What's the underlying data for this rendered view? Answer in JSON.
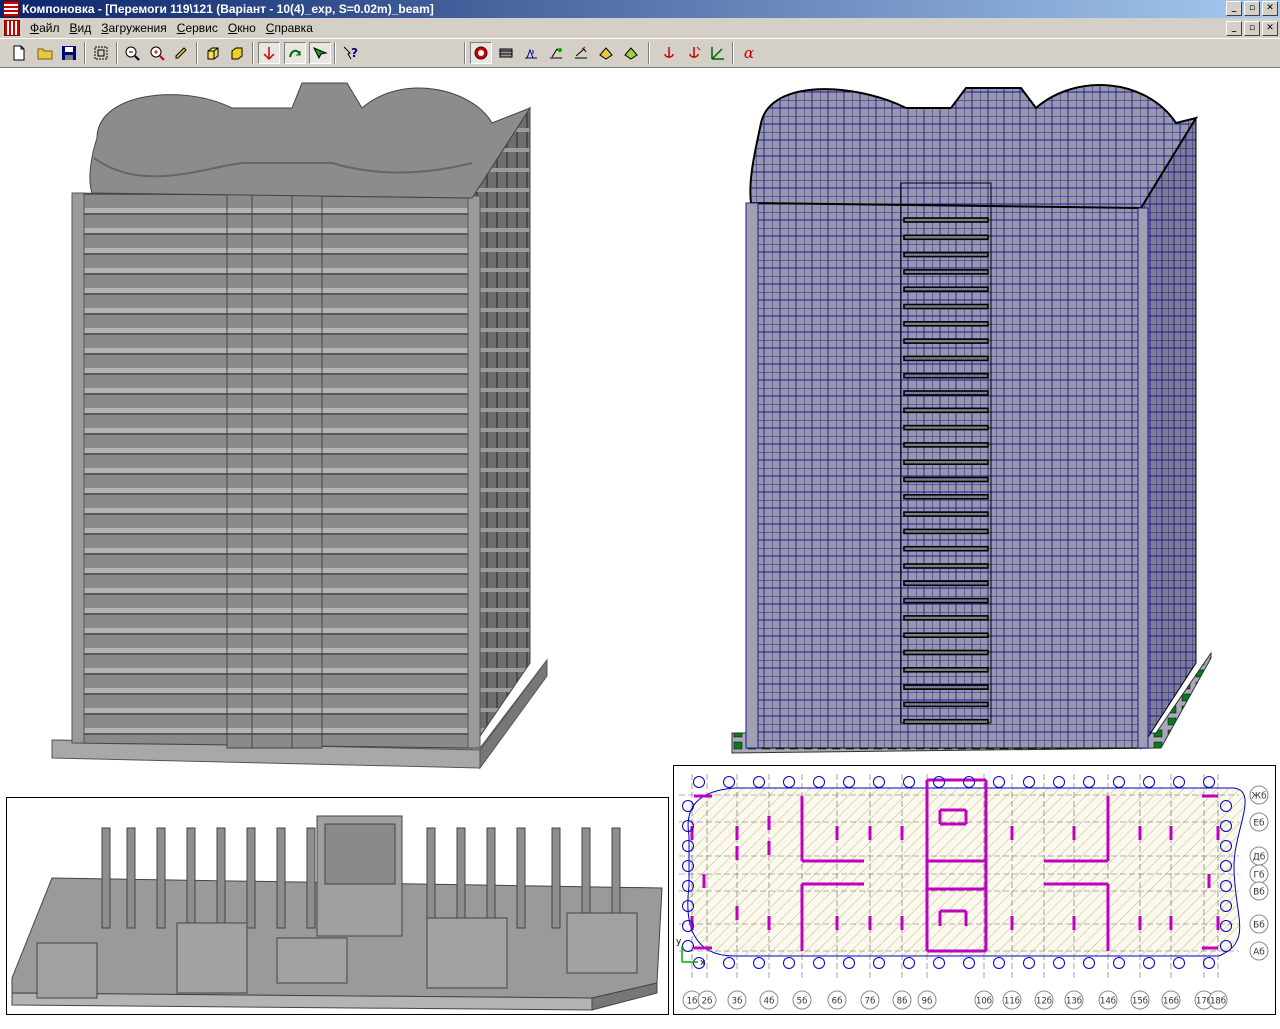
{
  "window": {
    "title": "Компоновка - [Перемоги 119\\121  (Варіант - 10(4)_exp, S=0.02m)_beam]",
    "controls": [
      "_",
      "▫",
      "✕"
    ]
  },
  "menu": {
    "items": [
      "Файл",
      "Вид",
      "Загружения",
      "Сервис",
      "Окно",
      "Справка"
    ],
    "mnemonics": [
      "Ф",
      "В",
      "З",
      "С",
      "О",
      "С"
    ]
  },
  "toolbar": {
    "buttons": [
      {
        "name": "new-icon",
        "glyph": "🗋"
      },
      {
        "name": "open-icon",
        "glyph": "📂"
      },
      {
        "name": "save-icon",
        "glyph": "💾"
      },
      {
        "name": "fit-icon",
        "glyph": "⛶"
      },
      {
        "name": "zoom-out-icon",
        "glyph": "🔍"
      },
      {
        "name": "zoom-in-icon",
        "glyph": "⊕"
      },
      {
        "name": "pencil-icon",
        "glyph": "✎"
      },
      {
        "name": "cube-icon",
        "glyph": "◧"
      },
      {
        "name": "cube-solid-icon",
        "glyph": "◨"
      },
      {
        "name": "axes-icon",
        "glyph": "⚓"
      },
      {
        "name": "rotate-icon",
        "glyph": "⟳"
      },
      {
        "name": "select-icon",
        "glyph": "⊳"
      },
      {
        "name": "help-icon",
        "glyph": "?"
      },
      {
        "name": "load-1-icon",
        "glyph": "☻"
      },
      {
        "name": "load-2-icon",
        "glyph": "▤"
      },
      {
        "name": "load-3-icon",
        "glyph": "⌁"
      },
      {
        "name": "load-4-icon",
        "glyph": "⌁"
      },
      {
        "name": "load-5-icon",
        "glyph": "⌁"
      },
      {
        "name": "load-6-icon",
        "glyph": "◈"
      },
      {
        "name": "load-7-icon",
        "glyph": "◈"
      },
      {
        "name": "anchor-1-icon",
        "glyph": "⚓"
      },
      {
        "name": "anchor-2-icon",
        "glyph": "⚓"
      },
      {
        "name": "vector-icon",
        "glyph": "↗"
      },
      {
        "name": "alpha-icon",
        "glyph": "α"
      }
    ]
  },
  "plan": {
    "row_labels": [
      "Жб",
      "Еб",
      "Дб",
      "Гб",
      "Вб",
      "Бб",
      "Аб"
    ],
    "column_labels": [
      "1б",
      "2б",
      "3б",
      "4б",
      "5б",
      "6б",
      "7б",
      "8б",
      "9б",
      "10б",
      "11б",
      "12б",
      "13б",
      "14б",
      "15б",
      "16б",
      "17б",
      "18б"
    ],
    "axis_y": "y",
    "axis_x": "x"
  },
  "colors": {
    "titlebar_start": "#0a246a",
    "titlebar_end": "#a6caf0",
    "model_gray": "#8c8c8c",
    "mesh_blue": "#1a1a9c",
    "support_green": "#0a7a1a",
    "wall_magenta": "#c000c0",
    "hatch": "#c8b878"
  }
}
